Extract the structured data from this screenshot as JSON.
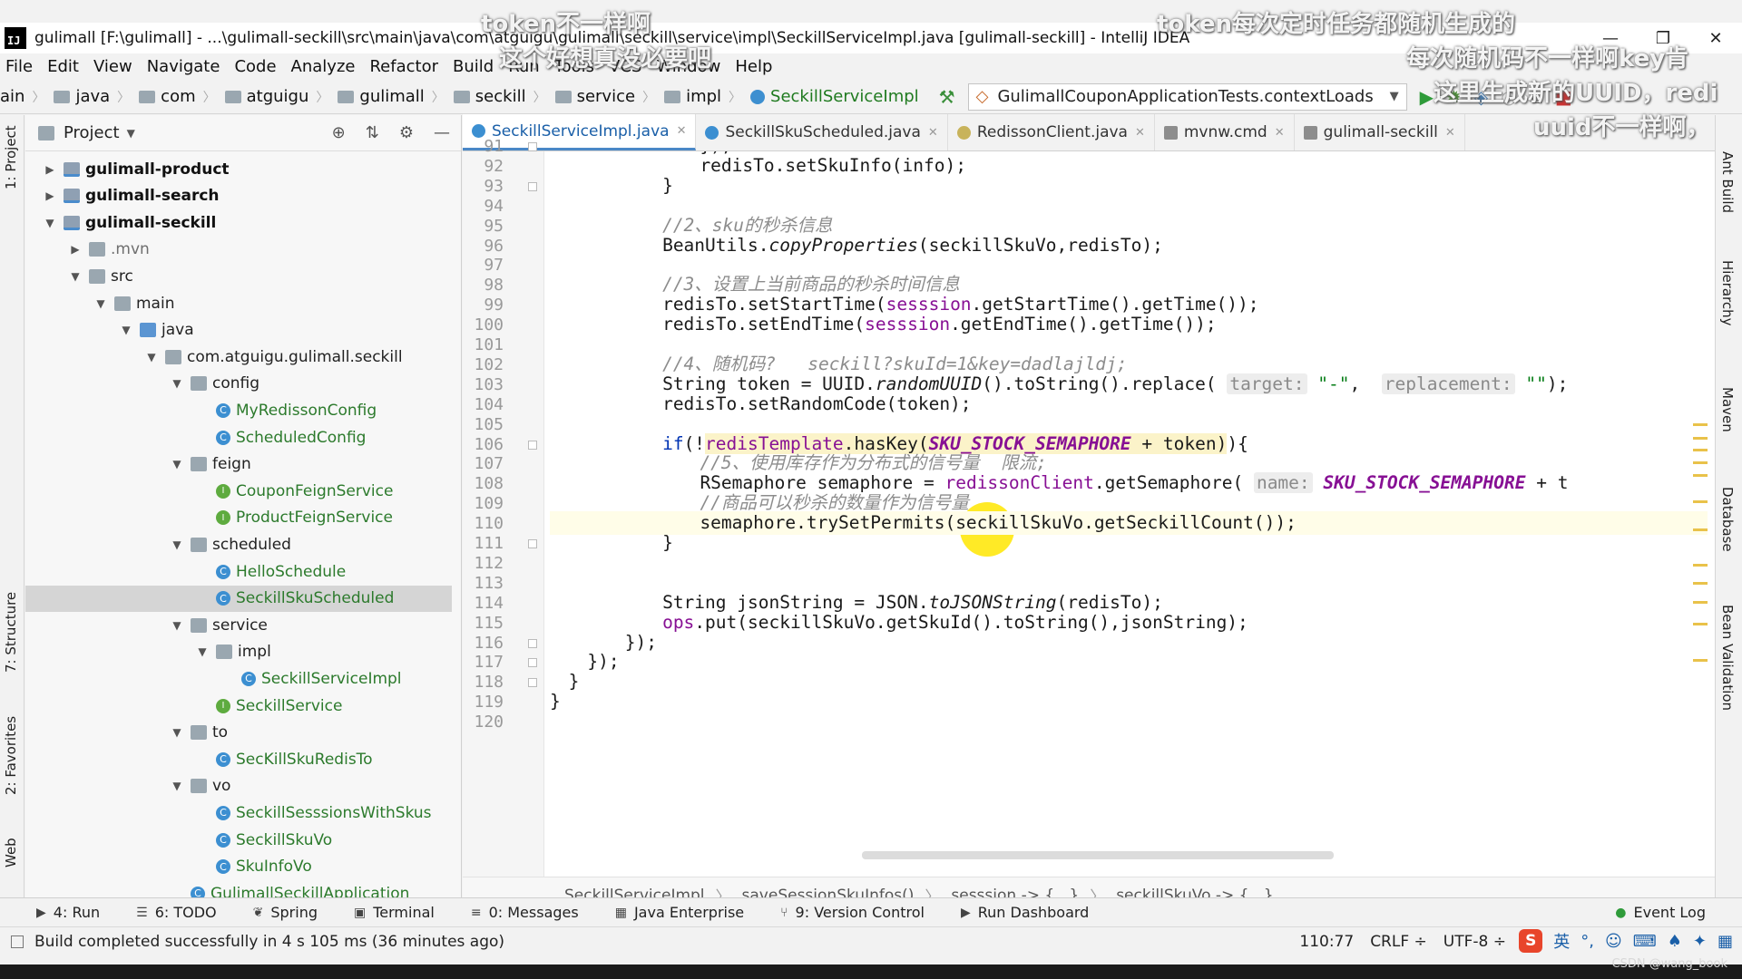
{
  "window": {
    "title": "gulimall [F:\\gulimall] - ...\\gulimall-seckill\\src\\main\\java\\com\\atguigu\\gulimall\\seckill\\service\\impl\\SeckillServiceImpl.java [gulimall-seckill] - IntelliJ IDEA",
    "logo_text": "IJ",
    "controls": [
      "—",
      "❐",
      "✕"
    ]
  },
  "menu": [
    "File",
    "Edit",
    "View",
    "Navigate",
    "Code",
    "Analyze",
    "Refactor",
    "Build",
    "Run",
    "Tools",
    "VCS",
    "Window",
    "Help"
  ],
  "navbar": {
    "crumbs": [
      "ain",
      "java",
      "com",
      "atguigu",
      "gulimall",
      "seckill",
      "service",
      "impl",
      "SeckillServiceImpl"
    ],
    "run_config": "GulimallCouponApplicationTests.contextLoads"
  },
  "project": {
    "title": "Project",
    "items": [
      {
        "label": "gulimall-product",
        "indent": 0,
        "arrow": "▶",
        "icon": "module",
        "style": "bold"
      },
      {
        "label": "gulimall-search",
        "indent": 0,
        "arrow": "▶",
        "icon": "module",
        "style": "bold"
      },
      {
        "label": "gulimall-seckill",
        "indent": 0,
        "arrow": "▼",
        "icon": "module",
        "style": "bold"
      },
      {
        "label": ".mvn",
        "indent": 1,
        "arrow": "▶",
        "icon": "folder",
        "style": "muted"
      },
      {
        "label": "src",
        "indent": 1,
        "arrow": "▼",
        "icon": "folder",
        "style": "plain"
      },
      {
        "label": "main",
        "indent": 2,
        "arrow": "▼",
        "icon": "folder",
        "style": "plain"
      },
      {
        "label": "java",
        "indent": 3,
        "arrow": "▼",
        "icon": "java",
        "style": "plain"
      },
      {
        "label": "com.atguigu.gulimall.seckill",
        "indent": 4,
        "arrow": "▼",
        "icon": "folder",
        "style": "plain"
      },
      {
        "label": "config",
        "indent": 5,
        "arrow": "▼",
        "icon": "folder",
        "style": "plain"
      },
      {
        "label": "MyRedissonConfig",
        "indent": 6,
        "arrow": "",
        "icon": "class",
        "style": "green"
      },
      {
        "label": "ScheduledConfig",
        "indent": 6,
        "arrow": "",
        "icon": "class",
        "style": "green"
      },
      {
        "label": "feign",
        "indent": 5,
        "arrow": "▼",
        "icon": "folder",
        "style": "plain"
      },
      {
        "label": "CouponFeignService",
        "indent": 6,
        "arrow": "",
        "icon": "iface",
        "style": "green"
      },
      {
        "label": "ProductFeignService",
        "indent": 6,
        "arrow": "",
        "icon": "iface",
        "style": "green"
      },
      {
        "label": "scheduled",
        "indent": 5,
        "arrow": "▼",
        "icon": "folder",
        "style": "plain"
      },
      {
        "label": "HelloSchedule",
        "indent": 6,
        "arrow": "",
        "icon": "class",
        "style": "green"
      },
      {
        "label": "SeckillSkuScheduled",
        "indent": 6,
        "arrow": "",
        "icon": "class",
        "style": "green",
        "selected": true
      },
      {
        "label": "service",
        "indent": 5,
        "arrow": "▼",
        "icon": "folder",
        "style": "plain"
      },
      {
        "label": "impl",
        "indent": 6,
        "arrow": "▼",
        "icon": "folder",
        "style": "plain"
      },
      {
        "label": "SeckillServiceImpl",
        "indent": 7,
        "arrow": "",
        "icon": "class",
        "style": "green"
      },
      {
        "label": "SeckillService",
        "indent": 6,
        "arrow": "",
        "icon": "iface",
        "style": "green"
      },
      {
        "label": "to",
        "indent": 5,
        "arrow": "▼",
        "icon": "folder",
        "style": "plain"
      },
      {
        "label": "SecKillSkuRedisTo",
        "indent": 6,
        "arrow": "",
        "icon": "class",
        "style": "green"
      },
      {
        "label": "vo",
        "indent": 5,
        "arrow": "▼",
        "icon": "folder",
        "style": "plain"
      },
      {
        "label": "SeckillSesssionsWithSkus",
        "indent": 6,
        "arrow": "",
        "icon": "class",
        "style": "green"
      },
      {
        "label": "SeckillSkuVo",
        "indent": 6,
        "arrow": "",
        "icon": "class",
        "style": "green"
      },
      {
        "label": "SkuInfoVo",
        "indent": 6,
        "arrow": "",
        "icon": "class",
        "style": "green"
      },
      {
        "label": "GulimallSeckillApplication",
        "indent": 5,
        "arrow": "",
        "icon": "class",
        "style": "green"
      }
    ]
  },
  "tabs": [
    {
      "label": "SeckillServiceImpl.java",
      "icon": "c",
      "active": true
    },
    {
      "label": "SeckillSkuScheduled.java",
      "icon": "c",
      "active": false
    },
    {
      "label": "RedissonClient.java",
      "icon": "r",
      "active": false
    },
    {
      "label": "mvnw.cmd",
      "icon": "m",
      "active": false
    },
    {
      "label": "gulimall-seckill",
      "icon": "m",
      "active": false
    }
  ],
  "editor": {
    "current_line": 110,
    "lines": [
      {
        "no": 91,
        "indent": 16,
        "segs": [
          [
            "",
            "});"
          ]
        ]
      },
      {
        "no": 92,
        "indent": 16,
        "segs": [
          [
            "",
            "redisTo.setSkuInfo(info);"
          ]
        ]
      },
      {
        "no": 93,
        "indent": 12,
        "segs": [
          [
            "",
            "}"
          ]
        ]
      },
      {
        "no": 94,
        "indent": 0,
        "segs": []
      },
      {
        "no": 95,
        "indent": 12,
        "segs": [
          [
            "c-comment",
            "//2、sku的秒杀信息"
          ]
        ]
      },
      {
        "no": 96,
        "indent": 12,
        "segs": [
          [
            "",
            "BeanUtils."
          ],
          [
            "c-italic",
            "copyProperties"
          ],
          [
            "",
            "(seckillSkuVo,redisTo);"
          ]
        ]
      },
      {
        "no": 97,
        "indent": 0,
        "segs": []
      },
      {
        "no": 98,
        "indent": 12,
        "segs": [
          [
            "c-comment",
            "//3、设置上当前商品的秒杀时间信息"
          ]
        ]
      },
      {
        "no": 99,
        "indent": 12,
        "segs": [
          [
            "",
            "redisTo.setStartTime("
          ],
          [
            "c-field",
            "sesssion"
          ],
          [
            "",
            ".getStartTime().getTime());"
          ]
        ]
      },
      {
        "no": 100,
        "indent": 12,
        "segs": [
          [
            "",
            "redisTo.setEndTime("
          ],
          [
            "c-field",
            "sesssion"
          ],
          [
            "",
            ".getEndTime().getTime());"
          ]
        ]
      },
      {
        "no": 101,
        "indent": 0,
        "segs": []
      },
      {
        "no": 102,
        "indent": 12,
        "segs": [
          [
            "c-comment",
            "//4、随机码?   seckill?skuId=1&key=dadlajldj;"
          ]
        ]
      },
      {
        "no": 103,
        "indent": 12,
        "segs": [
          [
            "",
            "String token = UUID."
          ],
          [
            "c-italic",
            "randomUUID"
          ],
          [
            "",
            "().toString().replace( "
          ],
          [
            "c-hint",
            "target:"
          ],
          [
            "",
            " "
          ],
          [
            "c-string",
            "\"-\""
          ],
          [
            "",
            ",  "
          ],
          [
            "c-hint",
            "replacement:"
          ],
          [
            "",
            " "
          ],
          [
            "c-string",
            "\"\""
          ],
          [
            "",
            ");"
          ]
        ]
      },
      {
        "no": 104,
        "indent": 12,
        "segs": [
          [
            "",
            "redisTo.setRandomCode(token);"
          ]
        ]
      },
      {
        "no": 105,
        "indent": 0,
        "segs": []
      },
      {
        "no": 106,
        "indent": 12,
        "segs": [
          [
            "c-keyword",
            "if"
          ],
          [
            "",
            "(!"
          ],
          [
            "c-field c-hl",
            "redisTemplate"
          ],
          [
            "c-hl",
            ".hasKey("
          ],
          [
            "c-const c-hl",
            "SKU_STOCK_SEMAPHORE"
          ],
          [
            "c-hl",
            " + token)"
          ],
          [
            "",
            "){"
          ]
        ]
      },
      {
        "no": 107,
        "indent": 16,
        "segs": [
          [
            "c-comment",
            "//5、使用库存作为分布式的信号量  限流;"
          ]
        ]
      },
      {
        "no": 108,
        "indent": 16,
        "segs": [
          [
            "",
            "RSemaphore semaphore = "
          ],
          [
            "c-field",
            "redissonClient"
          ],
          [
            "",
            ".getSemaphore( "
          ],
          [
            "c-hint",
            "name:"
          ],
          [
            "",
            " "
          ],
          [
            "c-const",
            "SKU_STOCK_SEMAPHORE"
          ],
          [
            "",
            " + t"
          ]
        ]
      },
      {
        "no": 109,
        "indent": 16,
        "segs": [
          [
            "c-comment",
            "//商品可以秒杀的数量作为信号量"
          ]
        ]
      },
      {
        "no": 110,
        "indent": 16,
        "segs": [
          [
            "",
            "semaphore.trySetPermits(seckillSkuVo.getSeckillCount());"
          ]
        ]
      },
      {
        "no": 111,
        "indent": 12,
        "segs": [
          [
            "",
            "}"
          ]
        ]
      },
      {
        "no": 112,
        "indent": 0,
        "segs": []
      },
      {
        "no": 113,
        "indent": 0,
        "segs": []
      },
      {
        "no": 114,
        "indent": 12,
        "segs": [
          [
            "",
            "String jsonString = JSON."
          ],
          [
            "c-italic",
            "toJSONString"
          ],
          [
            "",
            "(redisTo);"
          ]
        ]
      },
      {
        "no": 115,
        "indent": 12,
        "segs": [
          [
            "c-field",
            "ops"
          ],
          [
            "",
            ".put(seckillSkuVo.getSkuId().toString(),jsonString);"
          ]
        ]
      },
      {
        "no": 116,
        "indent": 8,
        "segs": [
          [
            "",
            "});"
          ]
        ]
      },
      {
        "no": 117,
        "indent": 4,
        "segs": [
          [
            "",
            "});"
          ]
        ]
      },
      {
        "no": 118,
        "indent": 2,
        "segs": [
          [
            "",
            "}"
          ]
        ]
      },
      {
        "no": 119,
        "indent": 0,
        "segs": [
          [
            "",
            "}"
          ]
        ]
      },
      {
        "no": 120,
        "indent": 0,
        "segs": []
      }
    ],
    "breadcrumbs": [
      "SeckillServiceImpl",
      "saveSessionSkuInfos()",
      "sesssion -> {...}",
      "seckillSkuVo -> {...}"
    ]
  },
  "side_tools": {
    "left": [
      "1: Project",
      "7: Structure",
      "2: Favorites",
      "Web"
    ],
    "right": [
      "Ant Build",
      "Hierarchy",
      "Maven",
      "Database",
      "Bean Validation"
    ]
  },
  "toolwindows": [
    "4: Run",
    "6: TODO",
    "Spring",
    "Terminal",
    "0: Messages",
    "Java Enterprise",
    "9: Version Control",
    "Run Dashboard"
  ],
  "event_log": "Event Log",
  "status": {
    "message": "Build completed successfully in 4 s 105 ms (36 minutes ago)",
    "position": "110:77",
    "line_sep": "CRLF ÷",
    "encoding": "UTF-8 ÷"
  },
  "ime": {
    "logo": "S",
    "lang": "英"
  },
  "watermark": "CSDN @wang_book",
  "subtitles": [
    "token不一样啊",
    "这个好想真没必要吧",
    "token每次定时任务都随机生成的",
    "每次随机码不一样啊key肯",
    "这里生成新的UUID，redi",
    "uuid不一样啊，"
  ]
}
